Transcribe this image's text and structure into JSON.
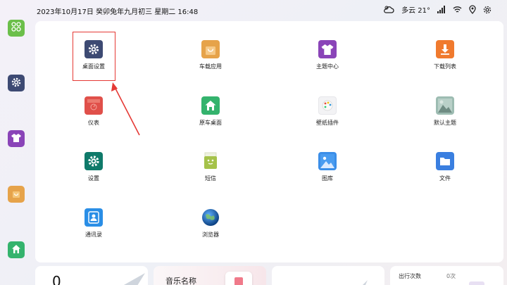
{
  "status": {
    "datetime": "2023年10月17日  癸卯兔年九月初三  星期二  16:48",
    "weather": "多云 21°"
  },
  "dock": [
    {
      "name": "apps",
      "icon": "apps-grid-icon",
      "color": "#6bbf4a"
    },
    {
      "name": "settings",
      "icon": "gear-icon",
      "color": "#3d4a73"
    },
    {
      "name": "theme",
      "icon": "shirt-icon",
      "color": "#8a44b8"
    },
    {
      "name": "store",
      "icon": "bag-icon",
      "color": "#e6a34a"
    },
    {
      "name": "home",
      "icon": "home-icon",
      "color": "#34b36d"
    }
  ],
  "apps": [
    {
      "label": "桌面设置",
      "icon": "gear-icon",
      "color": "#3d4a73"
    },
    {
      "label": "车载应用",
      "icon": "bag-icon",
      "color": "#e6a34a"
    },
    {
      "label": "主题中心",
      "icon": "shirt-icon",
      "color": "#8a44b8"
    },
    {
      "label": "下载列表",
      "icon": "download-icon",
      "color": "#f07a2e"
    },
    {
      "label": "仪表",
      "icon": "gauge-icon",
      "color": "#e0504a"
    },
    {
      "label": "原车桌面",
      "icon": "home-icon",
      "color": "#34b36d"
    },
    {
      "label": "壁纸插件",
      "icon": "palette-icon",
      "color": "#f2f2f2"
    },
    {
      "label": "默认主题",
      "icon": "landscape-icon",
      "color": "#7fa39a"
    },
    {
      "label": "设置",
      "icon": "gear-icon",
      "color": "#0f7a6a"
    },
    {
      "label": "短信",
      "icon": "message-icon",
      "color": "#a5c24a"
    },
    {
      "label": "图库",
      "icon": "image-icon",
      "color": "#3b8ee8"
    },
    {
      "label": "文件",
      "icon": "folder-icon",
      "color": "#3a7fe0"
    },
    {
      "label": "通讯录",
      "icon": "contacts-icon",
      "color": "#2a8ee6"
    },
    {
      "label": "浏览器",
      "icon": "globe-icon",
      "color": "#1f5fa8"
    }
  ],
  "widgets": {
    "w1_number": "0",
    "music_title": "音乐名称",
    "trips_label": "出行次数",
    "trips_value": "0次"
  }
}
